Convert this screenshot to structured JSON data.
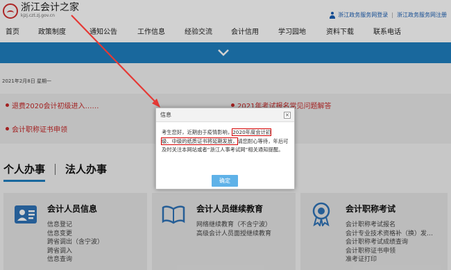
{
  "header": {
    "logo_title": "浙江会计之家",
    "logo_sub": "kjzj.czt.zj.gov.cn",
    "login_link": "浙江政务服务网登录",
    "register_link": "浙江政务服务网注册"
  },
  "nav": [
    "首页",
    "政策制度",
    "通知公告",
    "工作信息",
    "经验交流",
    "会计信用",
    "学习园地",
    "资料下载",
    "联系电话"
  ],
  "date": "2021年2月8日 星期一",
  "notices": {
    "left1": "退费2020会计初级进入……",
    "left2": "会计职称证书申领",
    "right1": "2021年考试报名常见问题解答"
  },
  "tabs": [
    "个人办事",
    "法人办事"
  ],
  "cards": [
    {
      "title": "会计人员信息",
      "links": [
        "信息登记",
        "信息变更",
        "跨省调出（含宁波）",
        "跨省调入",
        "信息查询"
      ]
    },
    {
      "title": "会计人员继续教育",
      "links": [
        "网络继续教育（不含宁波）",
        "高级会计人员面授继续教育"
      ]
    },
    {
      "title": "会计职称考试",
      "links": [
        "会计职称考试报名",
        "会计专业技术资格补（换）发…",
        "会计职称考试成绩查询",
        "会计职称证书申领",
        "准考证打印"
      ]
    }
  ],
  "dialog": {
    "title": "信息",
    "close": "×",
    "text_before": "考生您好，近期由于疫情影响，",
    "text_hl1": "2020年度会计初",
    "text_hl2": "级、中级的纸质证书将延期发放，",
    "text_after": "请您耐心等待，年后可及时关注本网站或者“浙江人事考试网”相关通知提醒。",
    "ok": "确定"
  },
  "colors": {
    "accent": "#1f7fc0",
    "notice_red": "#c62828",
    "highlight": "#d50000",
    "ok_button": "#5fb2e8"
  }
}
